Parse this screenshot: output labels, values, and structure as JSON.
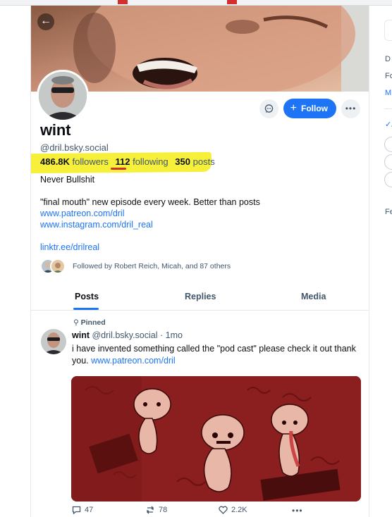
{
  "profile": {
    "display_name": "wint",
    "handle": "@dril.bsky.social",
    "followers_count": "486.8K",
    "followers_label": "followers",
    "following_count": "112",
    "following_label": "following",
    "posts_count": "350",
    "posts_label": "posts",
    "follow_label": "Follow",
    "bio": {
      "line1": "Never Bullshit",
      "line2": "\"final mouth\" new episode every week. Better than posts",
      "link1": "www.patreon.com/dril",
      "link2": "www.instagram.com/dril_real",
      "link3": "linktr.ee/drilreal"
    },
    "followed_by": "Followed by Robert Reich, Micah, and 87 others"
  },
  "tabs": [
    {
      "label": "Posts",
      "active": true
    },
    {
      "label": "Replies",
      "active": false
    },
    {
      "label": "Media",
      "active": false
    }
  ],
  "post": {
    "pinned_label": "Pinned",
    "author": "wint",
    "handle": "@dril.bsky.social",
    "separator": "·",
    "age": "1mo",
    "text": "i have invented something called the \"pod cast\" please check it out thank you.",
    "link": "www.patreon.com/dril",
    "replies": "47",
    "reposts": "78",
    "likes": "2.2K"
  },
  "sidebar_fragment": {
    "letter1": "D",
    "letter2": "Fo",
    "letter3": "M",
    "letter4": "✓/",
    "letter5": "Fe"
  },
  "colors": {
    "accent": "#1d74f5",
    "highlight": "#f7f03a",
    "underline": "#d32f2f",
    "post_image_bg": "#8b1e1e"
  },
  "icons": {
    "back": "arrow-left-icon",
    "message": "chat-bubble-icon",
    "follow": "plus-icon",
    "more": "ellipsis-icon",
    "pin": "pin-icon",
    "reply": "reply-icon",
    "repost": "repost-icon",
    "like": "heart-icon"
  }
}
